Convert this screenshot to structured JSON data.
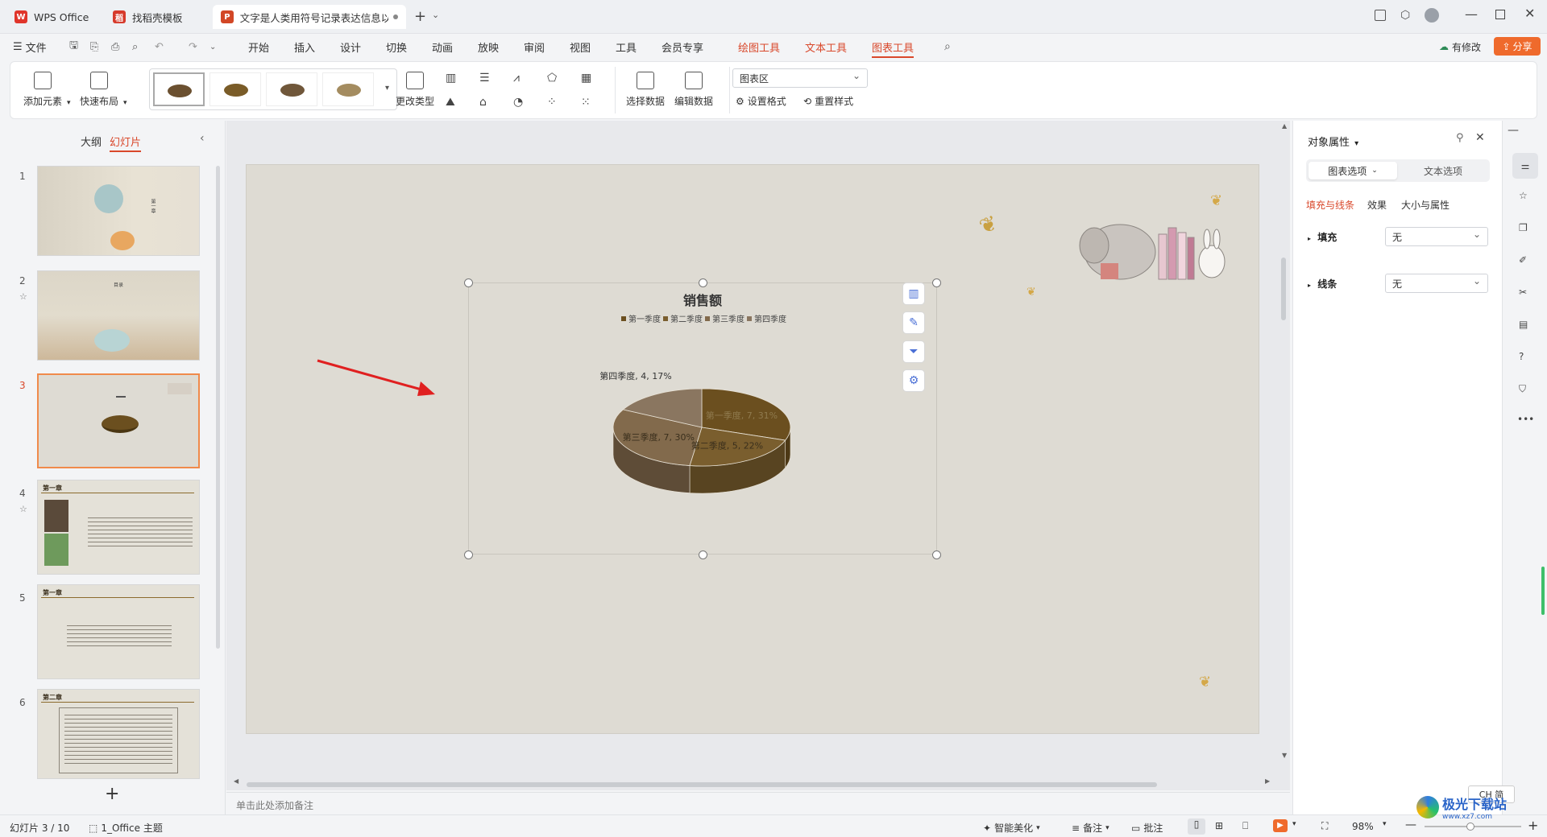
{
  "window": {
    "tabs": [
      {
        "label": "WPS Office"
      },
      {
        "label": "找稻壳模板"
      },
      {
        "label": "文字是人类用符号记录表达信息以"
      }
    ],
    "new_tab": "+"
  },
  "menubar": {
    "file": "文件",
    "items": [
      "开始",
      "插入",
      "设计",
      "切换",
      "动画",
      "放映",
      "审阅",
      "视图",
      "工具",
      "会员专享"
    ],
    "context_items": [
      "绘图工具",
      "文本工具",
      "图表工具"
    ],
    "has_changes": "有修改",
    "share": "分享"
  },
  "ribbon": {
    "add_element": "添加元素",
    "quick_layout": "快速布局",
    "change_type": "更改类型",
    "select_data": "选择数据",
    "edit_data": "编辑数据",
    "chart_area_select": "图表区",
    "set_format": "设置格式",
    "reset_style": "重置样式"
  },
  "left_pane": {
    "tab_outline": "大纲",
    "tab_slides": "幻灯片",
    "slides": [
      {
        "num": "1"
      },
      {
        "num": "2"
      },
      {
        "num": "3"
      },
      {
        "num": "4"
      },
      {
        "num": "5"
      },
      {
        "num": "6"
      }
    ],
    "add": "+",
    "slide4_heading": "第一章",
    "slide5_heading": "第一章",
    "slide6_heading": "第二章",
    "slide1_title": "第一章",
    "slide2_title": "目录"
  },
  "chart_data": {
    "type": "pie",
    "title": "销售额",
    "categories": [
      "第一季度",
      "第二季度",
      "第三季度",
      "第四季度"
    ],
    "values": [
      7,
      5,
      7,
      4
    ],
    "percents": [
      31,
      22,
      30,
      17
    ],
    "data_labels": [
      "第一季度, 7, 31%",
      "第二季度, 5, 22%",
      "第三季度, 7, 30%",
      "第四季度, 4, 17%"
    ],
    "colors": [
      "#6b4f1f",
      "#7a5e2e",
      "#826a4c",
      "#8a7660"
    ],
    "legend_position": "top",
    "3d": true
  },
  "notes_placeholder": "单击此处添加备注",
  "right_pane": {
    "title": "对象属性",
    "tab_chart": "图表选项",
    "tab_text": "文本选项",
    "sub_fill_line": "填充与线条",
    "sub_effect": "效果",
    "sub_size": "大小与属性",
    "fill_label": "填充",
    "fill_value": "无",
    "line_label": "线条",
    "line_value": "无"
  },
  "statusbar": {
    "slide_pos": "幻灯片 3 / 10",
    "theme": "1_Office 主题",
    "beautify": "智能美化",
    "notes": "备注",
    "comments": "批注",
    "zoom": "98%",
    "ime": "CH 简"
  },
  "watermark": "极光下载站",
  "watermark_url": "www.xz7.com"
}
